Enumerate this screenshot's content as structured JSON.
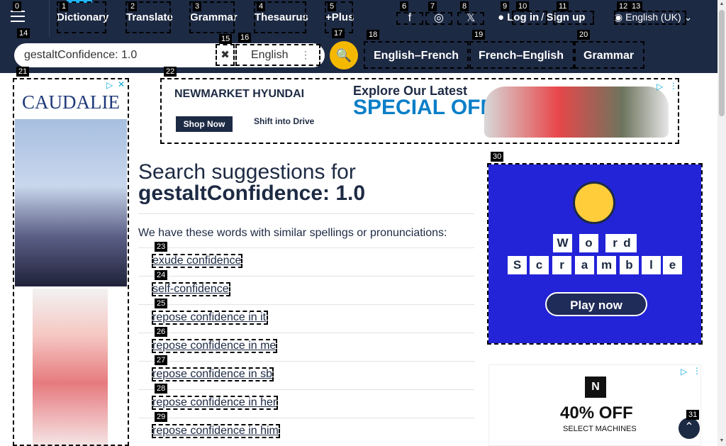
{
  "nav": {
    "items": [
      {
        "label": "Dictionary"
      },
      {
        "label": "Translate"
      },
      {
        "label": "Grammar"
      },
      {
        "label": "Thesaurus"
      },
      {
        "label": "+Plus"
      }
    ],
    "social": {
      "facebook": "f",
      "instagram": "◎",
      "x": "𝕏"
    },
    "login": "Log in",
    "signup": "Sign up",
    "slash": "/",
    "language": "English (UK)"
  },
  "search": {
    "value": "gestaltConfidence: 1.0",
    "clear": "✖",
    "dictionary": "English",
    "go": "🔍",
    "quick_links": [
      "English–French",
      "French–English",
      "Grammar"
    ]
  },
  "ads": {
    "left_brand": "CAUDALIE",
    "top_brand": "NEWMARKET HYUNDAI",
    "top_headline": "Explore Our Latest",
    "top_big": "SPECIAL OFFERS",
    "top_shop": "Shop Now",
    "top_shift": "Shift into Drive",
    "right_word": [
      "W",
      "o",
      "r",
      "d"
    ],
    "right_scramble": [
      "S",
      "c",
      "r",
      "a",
      "m",
      "b",
      "l",
      "e"
    ],
    "right_play": "Play now",
    "right2_pct": "40% OFF",
    "right2_sub": "SELECT MACHINES"
  },
  "main": {
    "title_prefix": "Search suggestions for",
    "title_query": "gestaltConfidence: 1.0",
    "intro": "We have these words with similar spellings or pronunciations:",
    "suggestions": [
      "exude confidence",
      "self-confidence",
      "repose confidence in it",
      "repose confidence in me",
      "repose confidence in sb",
      "repose confidence in her",
      "repose confidence in him"
    ]
  },
  "overlay_tags": [
    "0",
    "1",
    "2",
    "3",
    "4",
    "5",
    "6",
    "7",
    "8",
    "9",
    "10",
    "11",
    "12",
    "13",
    "14",
    "15",
    "16",
    "17",
    "18",
    "19",
    "20",
    "21",
    "22",
    "23",
    "24",
    "25",
    "26",
    "27",
    "28",
    "29",
    "30",
    "31"
  ],
  "colors": {
    "navy": "#1d2a44",
    "accent": "#f5b800",
    "link": "#1fb6ff"
  }
}
